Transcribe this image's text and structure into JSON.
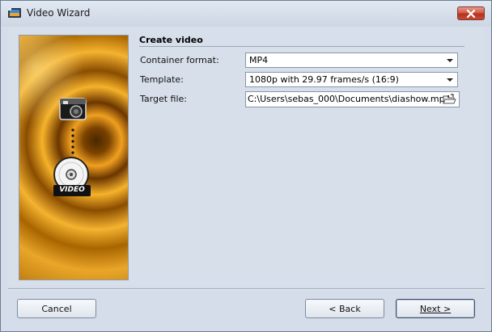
{
  "window": {
    "title": "Video Wizard"
  },
  "icons": {
    "app": "video-wizard-app-icon",
    "close": "close-icon",
    "camera": "camera-icon",
    "disc": "dvd-disc-icon",
    "folder": "open-folder-icon",
    "dropdown": "chevron-down-icon"
  },
  "banner": {
    "badge_text": "VIDEO"
  },
  "section": {
    "title": "Create video"
  },
  "form": {
    "container_format": {
      "label": "Container format:",
      "value": "MP4"
    },
    "template": {
      "label": "Template:",
      "value": "1080p with 29.97 frames/s (16:9)"
    },
    "target_file": {
      "label": "Target file:",
      "value": "C:\\Users\\sebas_000\\Documents\\diashow.mp4"
    }
  },
  "buttons": {
    "cancel": "Cancel",
    "back": "< Back",
    "next": "Next >"
  },
  "colors": {
    "close_button": "#c94b35",
    "banner_orange": "#f0a020",
    "window_bg": "#d4dde9"
  }
}
